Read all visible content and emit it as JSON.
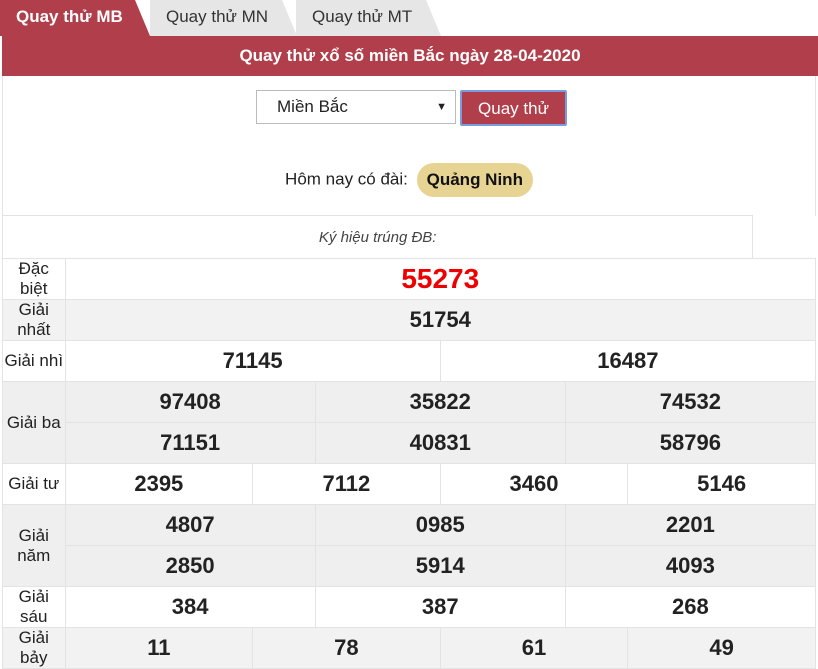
{
  "tabs": [
    "Quay thử MB",
    "Quay thử MN",
    "Quay thử MT"
  ],
  "header_title": "Quay thử xổ số miền Bắc ngày 28-04-2020",
  "region_select": "Miền Bắc",
  "spin_button": "Quay thử",
  "today_label": "Hôm nay có đài:",
  "today_station": "Quảng Ninh",
  "symbol_label": "Ký hiệu trúng ĐB:",
  "prizes": {
    "db": {
      "label": "Đặc biệt",
      "values": [
        "55273"
      ]
    },
    "g1": {
      "label": "Giải nhất",
      "values": [
        "51754"
      ]
    },
    "g2": {
      "label": "Giải nhì",
      "values": [
        "71145",
        "16487"
      ]
    },
    "g3": {
      "label": "Giải ba",
      "values": [
        "97408",
        "35822",
        "74532",
        "71151",
        "40831",
        "58796"
      ]
    },
    "g4": {
      "label": "Giải tư",
      "values": [
        "2395",
        "7112",
        "3460",
        "5146"
      ]
    },
    "g5": {
      "label": "Giải năm",
      "values": [
        "4807",
        "0985",
        "2201",
        "2850",
        "5914",
        "4093"
      ]
    },
    "g6": {
      "label": "Giải sáu",
      "values": [
        "384",
        "387",
        "268"
      ]
    },
    "g7": {
      "label": "Giải bảy",
      "values": [
        "11",
        "78",
        "61",
        "49"
      ]
    }
  },
  "colors": {
    "brand": "#b13f4b",
    "special": "#e00000",
    "badge": "#e7d392"
  }
}
